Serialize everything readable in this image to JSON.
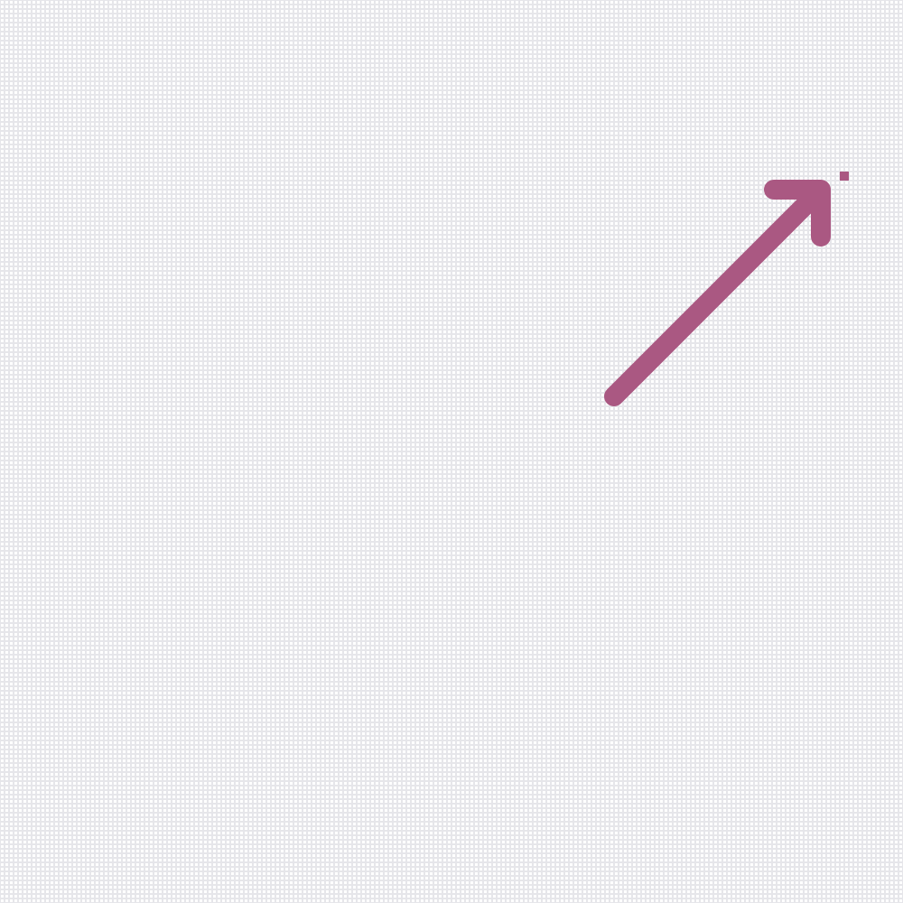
{
  "canvas": {
    "background": "#ffffff",
    "grid_color": "#e9e9ee"
  },
  "arrow": {
    "icon": "arrow-up-right-icon",
    "direction": "up-right",
    "color": "#aa5882"
  },
  "cursor_marker": {
    "color": "#aa5882"
  }
}
